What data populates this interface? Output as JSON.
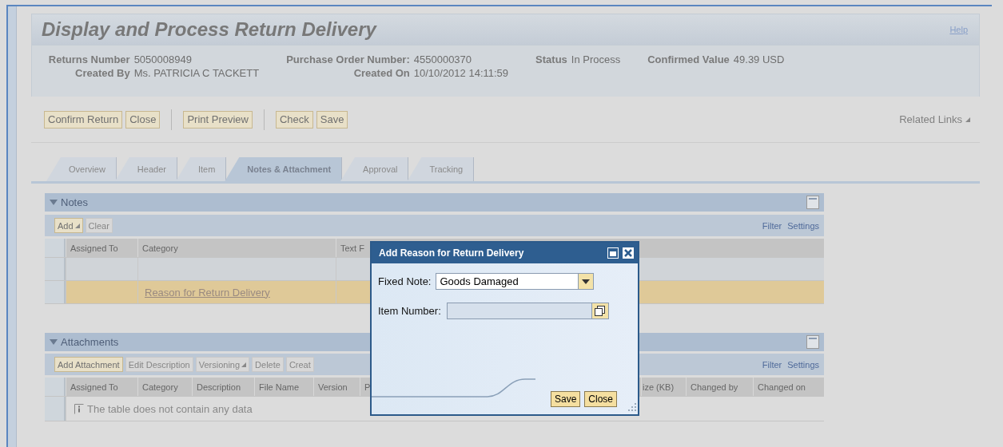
{
  "page": {
    "title": "Display and Process Return Delivery",
    "help_link": "Help"
  },
  "info": {
    "rows": [
      [
        {
          "label": "Returns Number",
          "value": "5050008949"
        },
        {
          "label": "Purchase Order Number:",
          "value": "4550000370"
        },
        {
          "label": "Status",
          "value": "In Process"
        },
        {
          "label": "Confirmed Value",
          "value": "49.39 USD"
        }
      ],
      [
        {
          "label": "Created By",
          "value": "Ms. PATRICIA C TACKETT"
        },
        {
          "label": "Created On",
          "value": "10/10/2012 14:11:59"
        }
      ]
    ]
  },
  "toolbar": {
    "groups": [
      [
        "Confirm Return",
        "Close"
      ],
      [
        "Print Preview"
      ],
      [
        "Check",
        "Save"
      ]
    ],
    "related_links": "Related Links"
  },
  "tabs": [
    {
      "label": "Overview",
      "selected": false
    },
    {
      "label": "Header",
      "selected": false
    },
    {
      "label": "Item",
      "selected": false
    },
    {
      "label": "Notes & Attachment",
      "selected": true
    },
    {
      "label": "Approval",
      "selected": false
    },
    {
      "label": "Tracking",
      "selected": false
    }
  ],
  "notes": {
    "title": "Notes",
    "expanded": true,
    "buttons": [
      {
        "label": "Add",
        "disabled": false,
        "menu": true
      },
      {
        "label": "Clear",
        "disabled": true,
        "menu": false
      }
    ],
    "links": [
      "Filter",
      "Settings"
    ],
    "columns": [
      "Assigned To",
      "Category",
      "Text F"
    ],
    "rows": [
      {
        "selected": false
      },
      {
        "selected": true,
        "category": "Reason for Return Delivery"
      }
    ]
  },
  "attachments": {
    "title": "Attachments",
    "expanded": true,
    "buttons": [
      {
        "label": "Add Attachment",
        "disabled": false,
        "menu": false
      },
      {
        "label": "Edit Description",
        "disabled": true,
        "menu": false
      },
      {
        "label": "Versioning",
        "disabled": true,
        "menu": true
      },
      {
        "label": "Delete",
        "disabled": true,
        "menu": false
      },
      {
        "label": "Creat",
        "disabled": true,
        "menu": false
      }
    ],
    "links": [
      "Filter",
      "Settings"
    ],
    "columns": [
      "Assigned To",
      "Category",
      "Description",
      "File Name",
      "Version",
      "P",
      "ize (KB)",
      "Changed by",
      "Changed on"
    ],
    "empty_message": "The table does not contain any data"
  },
  "dialog": {
    "title": "Add Reason for Return Delivery",
    "fields": [
      {
        "kind": "dropdown",
        "label": "Fixed Note:",
        "value": "Goods Damaged"
      },
      {
        "kind": "value_help",
        "label": "Item Number:"
      }
    ],
    "buttons": [
      "Save",
      "Close"
    ]
  }
}
